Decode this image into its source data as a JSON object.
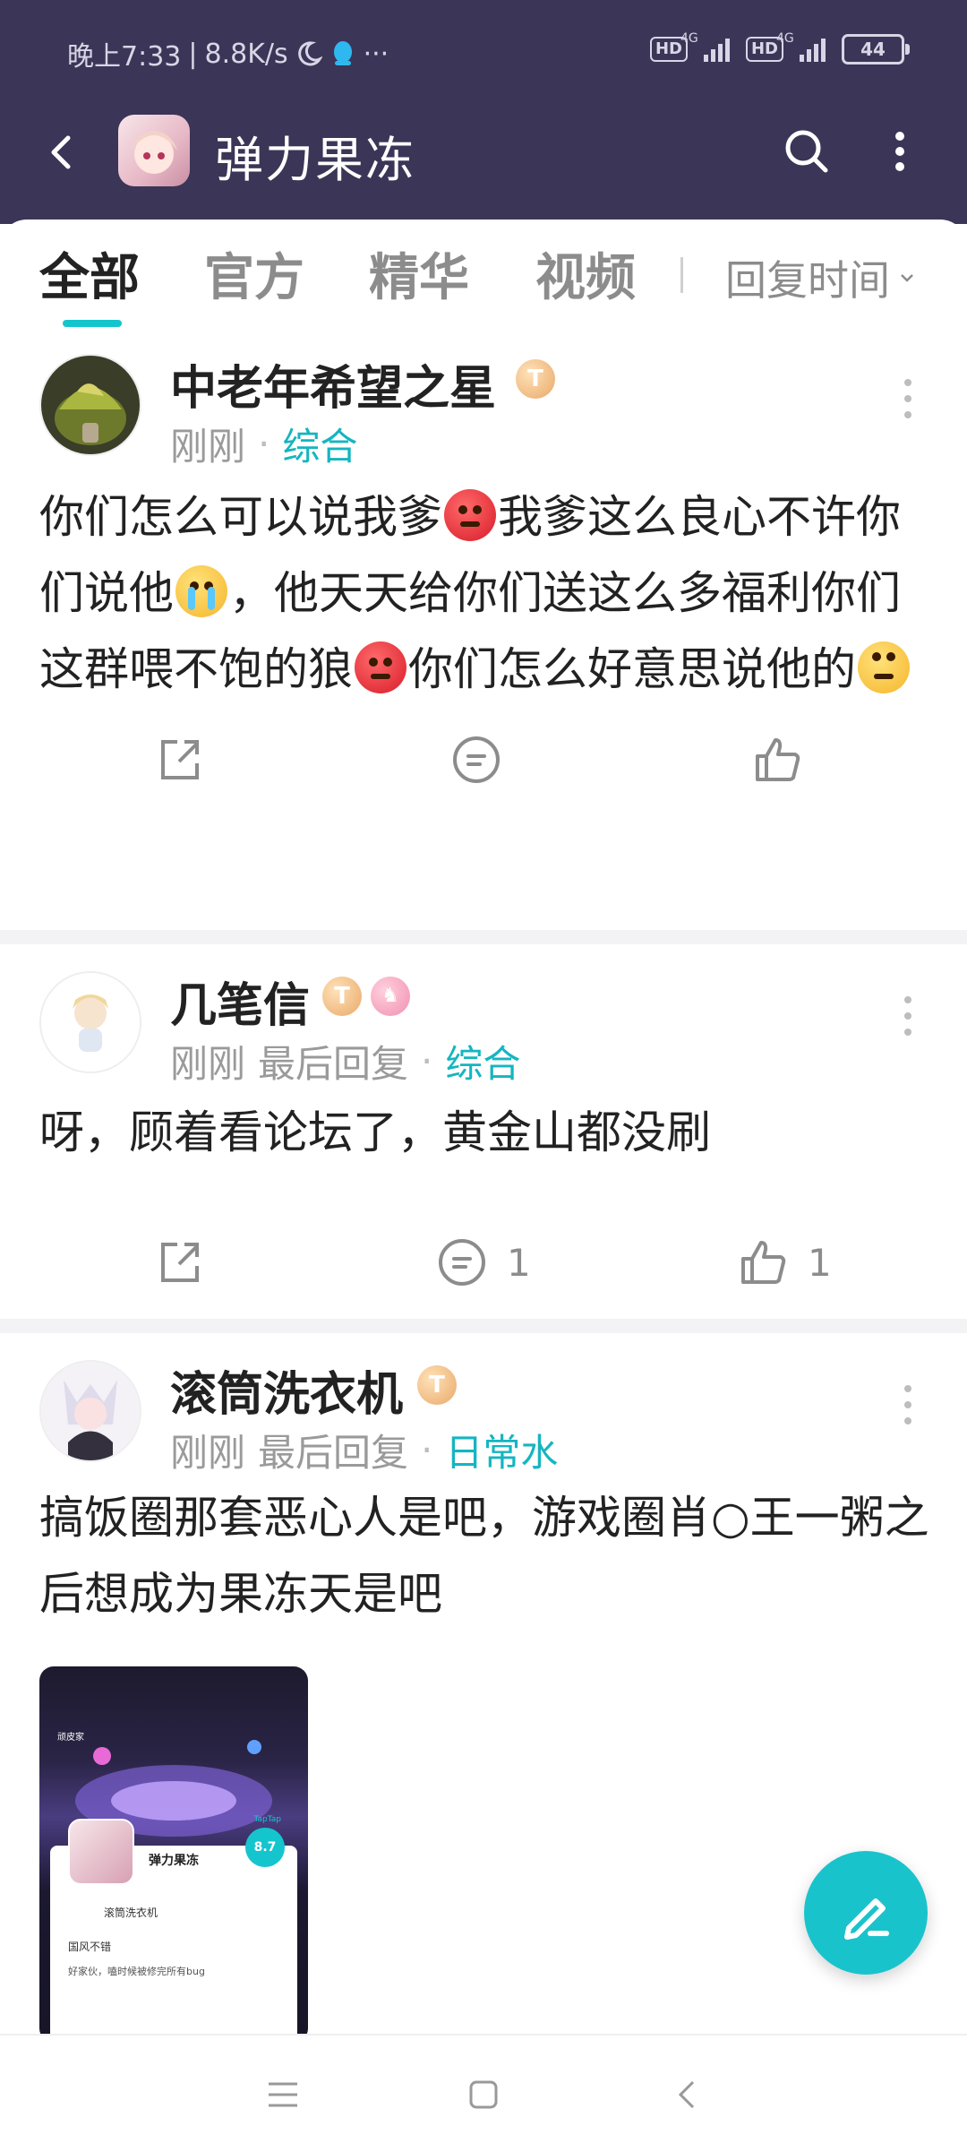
{
  "status_bar": {
    "time": "晚上7:33",
    "speed": "8.8K/s",
    "more": "···",
    "hd1": "HD",
    "net1": "4G",
    "hd2": "HD",
    "net2": "4G",
    "battery": "44"
  },
  "header": {
    "title": "弹力果冻"
  },
  "tabs": [
    {
      "label": "全部"
    },
    {
      "label": "官方"
    },
    {
      "label": "精华"
    },
    {
      "label": "视频"
    }
  ],
  "sort": {
    "label": "回复时间"
  },
  "posts": [
    {
      "author": "中老年希望之星",
      "badge": "T",
      "time": "刚刚",
      "category": "综合",
      "text_parts": [
        "你们怎么可以说我爹",
        "我爹这么良心不许你们说他",
        "，他天天给你们送这么多福利你们这群喂不饱的狼",
        "你们怎么好意思说他的"
      ]
    },
    {
      "author": "几笔信",
      "badge": "T",
      "time": "刚刚",
      "last_reply": "最后回复",
      "category": "综合",
      "text": "呀，顾着看论坛了，黄金山都没刷",
      "comment_count": "1",
      "like_count": "1"
    },
    {
      "author": "滚筒洗衣机",
      "badge": "T",
      "time": "刚刚",
      "last_reply": "最后回复",
      "category": "日常水",
      "text": "搞饭圈那套恶心人是吧，游戏圈肖○王一粥之后想成为果冻天是吧",
      "image": {
        "logo": "顽皮家",
        "app_name": "弹力果冻",
        "score_label": "TapTap",
        "score": "8.7",
        "user": "滚筒洗衣机",
        "line1": "国风不错",
        "line2": "好家伙，嗑时候被修完所有bug"
      }
    }
  ],
  "colors": {
    "header_bg": "#3b3557",
    "accent": "#15c5ce",
    "category_text": "#15b5c0"
  }
}
